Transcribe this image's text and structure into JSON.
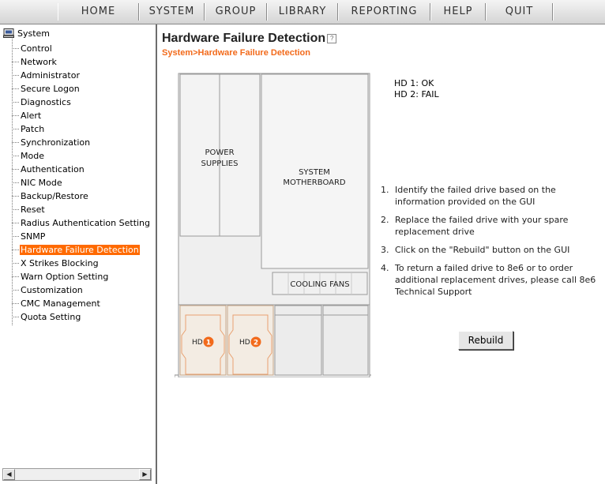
{
  "menu": {
    "items": [
      {
        "label": "HOME"
      },
      {
        "label": "SYSTEM"
      },
      {
        "label": "GROUP"
      },
      {
        "label": "LIBRARY"
      },
      {
        "label": "REPORTING"
      },
      {
        "label": "HELP"
      },
      {
        "label": "QUIT"
      }
    ]
  },
  "sidebar": {
    "root": "System",
    "items": [
      {
        "label": "Control"
      },
      {
        "label": "Network"
      },
      {
        "label": "Administrator"
      },
      {
        "label": "Secure Logon"
      },
      {
        "label": "Diagnostics"
      },
      {
        "label": "Alert"
      },
      {
        "label": "Patch"
      },
      {
        "label": "Synchronization"
      },
      {
        "label": "Mode"
      },
      {
        "label": "Authentication"
      },
      {
        "label": "NIC Mode"
      },
      {
        "label": "Backup/Restore"
      },
      {
        "label": "Reset"
      },
      {
        "label": "Radius Authentication Setting"
      },
      {
        "label": "SNMP"
      },
      {
        "label": "Hardware Failure Detection",
        "selected": true
      },
      {
        "label": "X Strikes Blocking"
      },
      {
        "label": "Warn Option Setting"
      },
      {
        "label": "Customization"
      },
      {
        "label": "CMC Management"
      },
      {
        "label": "Quota Setting"
      }
    ]
  },
  "main": {
    "title": "Hardware Failure Detection",
    "breadcrumb": "System>Hardware Failure Detection",
    "chassis": {
      "power_supplies": [
        "POWER",
        "SUPPLIES"
      ],
      "motherboard": [
        "SYSTEM",
        "MOTHERBOARD"
      ],
      "cooling_fans": "COOLING FANS",
      "hd_label": "HD",
      "drives": [
        {
          "number": "1"
        },
        {
          "number": "2"
        }
      ]
    },
    "status": [
      {
        "text": "HD 1: OK"
      },
      {
        "text": "HD 2: FAIL"
      }
    ],
    "instructions": [
      {
        "num": "1.",
        "text": "Identify the failed drive based on the information provided on the GUI"
      },
      {
        "num": "2.",
        "text": "Replace the failed drive with your spare replacement drive"
      },
      {
        "num": "3.",
        "text": "Click on the \"Rebuild\" button on the GUI"
      },
      {
        "num": "4.",
        "text": "To return a failed drive to 8e6 or to order additional replacement drives, please call 8e6 Technical Support"
      }
    ],
    "rebuild_label": "Rebuild"
  },
  "colors": {
    "accent": "#f26a1b",
    "selected_bg": "#ff6a00",
    "drive_badge": "#f26a1b"
  },
  "icons": {
    "root": "computer-icon",
    "help": "help-icon",
    "scroll_left": "arrow-left-icon",
    "scroll_right": "arrow-right-icon"
  }
}
